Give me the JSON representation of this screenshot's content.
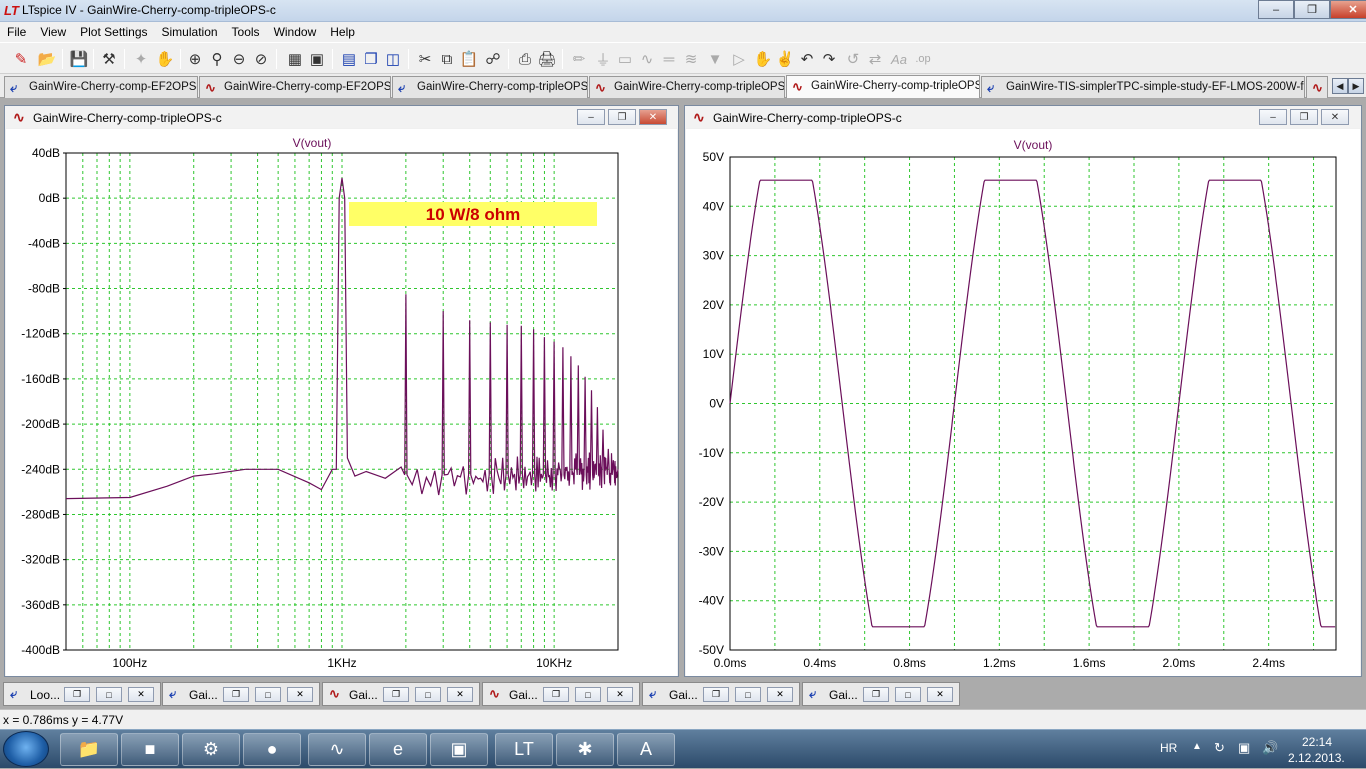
{
  "window": {
    "title": "LTspice IV - GainWire-Cherry-comp-tripleOPS-c",
    "app_icon": "ltspice-logo-icon"
  },
  "menu": [
    "File",
    "View",
    "Plot Settings",
    "Simulation",
    "Tools",
    "Window",
    "Help"
  ],
  "tabs": [
    {
      "label": "GainWire-Cherry-comp-EF2OPS-c",
      "icon": "schematic-icon"
    },
    {
      "label": "GainWire-Cherry-comp-EF2OPS-c",
      "icon": "waveform-icon"
    },
    {
      "label": "GainWire-Cherry-comp-tripleOPS-c",
      "icon": "schematic-icon"
    },
    {
      "label": "GainWire-Cherry-comp-tripleOPS-c",
      "icon": "waveform-icon"
    },
    {
      "label": "GainWire-Cherry-comp-tripleOPS-c",
      "icon": "waveform-icon",
      "active": true
    },
    {
      "label": "GainWire-TIS-simplerTPC-simple-study-EF-LMOS-200W-final-c",
      "icon": "schematic-icon"
    }
  ],
  "panes": {
    "left": {
      "title": "GainWire-Cherry-comp-tripleOPS-c",
      "trace": "V(vout)",
      "annotation": "10 W/8 ohm"
    },
    "right": {
      "title": "GainWire-Cherry-comp-tripleOPS-c",
      "trace": "V(vout)"
    }
  },
  "chart_data": [
    {
      "type": "line",
      "trace": "V(vout)",
      "x_scale": "log",
      "xlim": [
        50,
        20000
      ],
      "ylim": [
        -400,
        40
      ],
      "y_ticks": [
        "40dB",
        "0dB",
        "-40dB",
        "-80dB",
        "-120dB",
        "-160dB",
        "-200dB",
        "-240dB",
        "-280dB",
        "-320dB",
        "-360dB",
        "-400dB"
      ],
      "x_ticks": [
        "100Hz",
        "1KHz",
        "10KHz"
      ],
      "grid": true,
      "noise_floor": [
        [
          50,
          -266
        ],
        [
          100,
          -265
        ],
        [
          150,
          -255
        ],
        [
          200,
          -246
        ],
        [
          250,
          -244
        ],
        [
          350,
          -240
        ],
        [
          500,
          -240
        ],
        [
          700,
          -252
        ],
        [
          800,
          -258
        ],
        [
          900,
          -240
        ]
      ],
      "peaks": [
        {
          "f": 1000,
          "dB": 18
        },
        {
          "f": 2000,
          "dB": -85
        },
        {
          "f": 3000,
          "dB": -100
        },
        {
          "f": 4000,
          "dB": -108
        },
        {
          "f": 5000,
          "dB": -110
        },
        {
          "f": 6000,
          "dB": -112
        },
        {
          "f": 7000,
          "dB": -113
        },
        {
          "f": 8000,
          "dB": -116
        },
        {
          "f": 9000,
          "dB": -123
        },
        {
          "f": 10000,
          "dB": -127
        },
        {
          "f": 11000,
          "dB": -132
        },
        {
          "f": 12000,
          "dB": -140
        },
        {
          "f": 13000,
          "dB": -148
        },
        {
          "f": 14000,
          "dB": -158
        },
        {
          "f": 15000,
          "dB": -170
        },
        {
          "f": 16000,
          "dB": -185
        },
        {
          "f": 17000,
          "dB": -205
        },
        {
          "f": 18000,
          "dB": -222
        },
        {
          "f": 19000,
          "dB": -232
        }
      ]
    },
    {
      "type": "line",
      "trace": "V(vout)",
      "xlim": [
        0,
        2.7
      ],
      "ylim": [
        -50,
        50
      ],
      "y_ticks": [
        "50V",
        "40V",
        "30V",
        "20V",
        "10V",
        "0V",
        "-10V",
        "-20V",
        "-30V",
        "-40V",
        "-50V"
      ],
      "x_ticks": [
        "0.0ms",
        "0.4ms",
        "0.8ms",
        "1.2ms",
        "1.6ms",
        "2.0ms",
        "2.4ms"
      ],
      "grid": true,
      "signal": {
        "amplitude": 61,
        "frequency_khz": 1,
        "clip_level": 45.3
      }
    }
  ],
  "mini_windows": [
    {
      "label": "Loo...",
      "icon": "schematic-icon"
    },
    {
      "label": "Gai...",
      "icon": "schematic-icon"
    },
    {
      "label": "Gai...",
      "icon": "waveform-icon"
    },
    {
      "label": "Gai...",
      "icon": "waveform-icon"
    },
    {
      "label": "Gai...",
      "icon": "schematic-icon"
    },
    {
      "label": "Gai...",
      "icon": "schematic-icon"
    }
  ],
  "status": "x = 0.786ms   y = 4.77V",
  "tray": {
    "lang": "HR",
    "time": "22:14",
    "date": "2.12.2013."
  }
}
